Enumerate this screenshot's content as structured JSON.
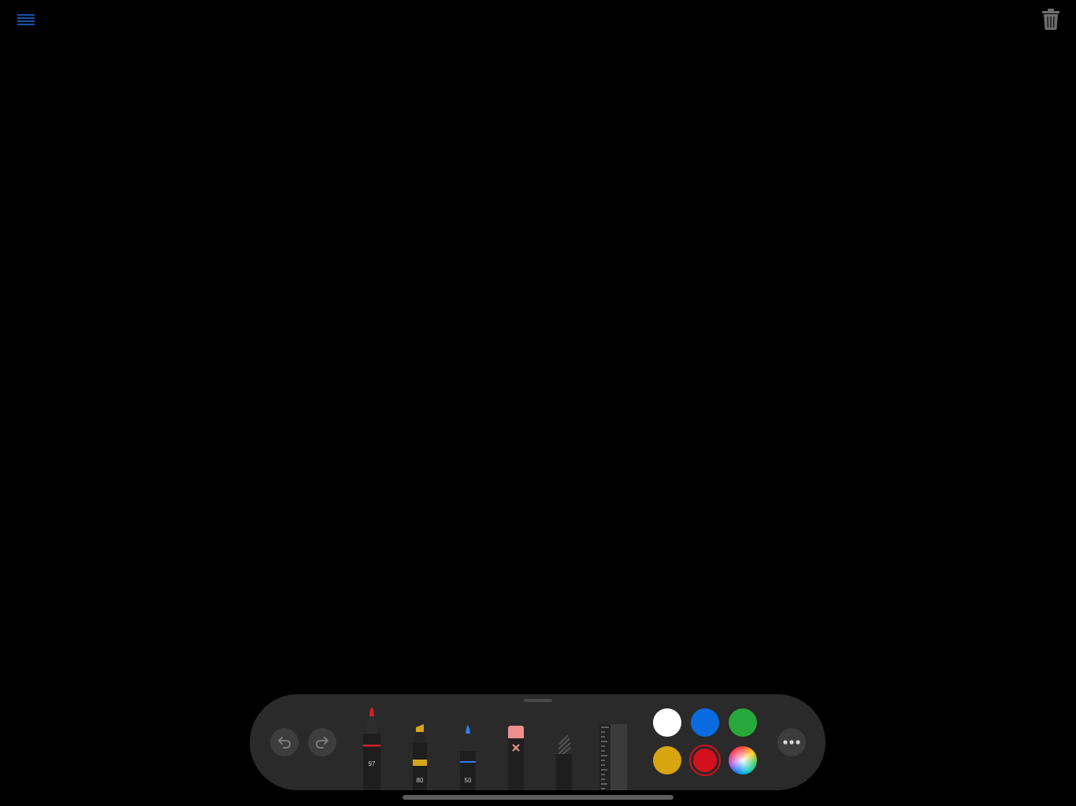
{
  "icons": {
    "menu": "menu-lines-icon",
    "trash": "trash-icon",
    "undo": "undo-arrow-icon",
    "redo": "redo-arrow-icon",
    "more": "ellipsis-icon"
  },
  "colors": {
    "accent": "#1e6fe0",
    "toolbar_bg": "#2a2a2a",
    "button_bg": "#3d3d3d"
  },
  "tools": [
    {
      "name": "pen",
      "label": "97",
      "tip_color": "#d0202a"
    },
    {
      "name": "marker",
      "label": "80",
      "tip_color": "#d4a51a"
    },
    {
      "name": "pencil",
      "label": "50",
      "tip_color": "#2f7de8"
    },
    {
      "name": "eraser",
      "label": "",
      "tip_color": "#f08f8f"
    },
    {
      "name": "lasso",
      "label": "",
      "tip_color": "#555555"
    },
    {
      "name": "ruler",
      "label": "",
      "tip_color": "#444444"
    }
  ],
  "swatches": [
    {
      "name": "white",
      "color": "#ffffff",
      "selected": false
    },
    {
      "name": "blue",
      "color": "#0a6be0",
      "selected": false
    },
    {
      "name": "green",
      "color": "#26a83a",
      "selected": false
    },
    {
      "name": "yellow",
      "color": "#d6a50f",
      "selected": false
    },
    {
      "name": "red",
      "color": "#d4101c",
      "selected": true
    },
    {
      "name": "color-wheel",
      "color": "multicolor",
      "selected": false
    }
  ]
}
